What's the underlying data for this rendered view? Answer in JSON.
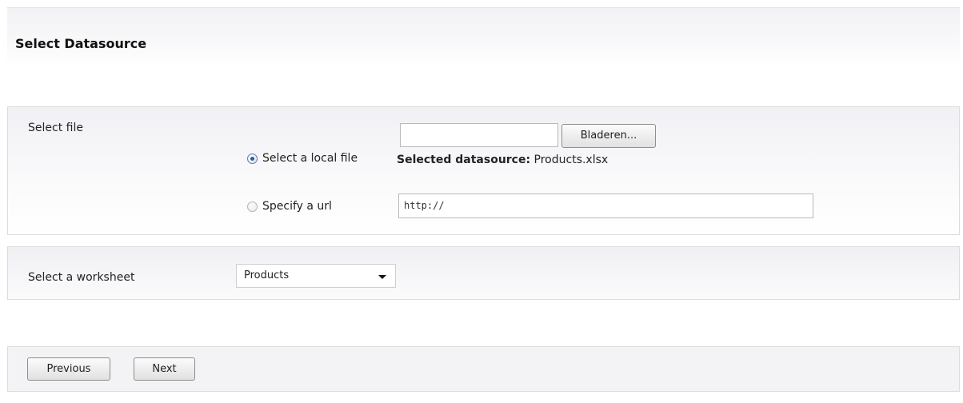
{
  "header": {
    "title": "Select Datasource"
  },
  "file_section": {
    "label": "Select file",
    "file_input": {
      "value": "",
      "browse_label": "Bladeren..."
    },
    "local_option": {
      "label": "Select a local file",
      "selected": true
    },
    "selected_datasource": {
      "label": "Selected datasource:",
      "value": "Products.xlsx"
    },
    "url_option": {
      "label": "Specify a url",
      "selected": false
    },
    "url_input": {
      "value": "http://"
    }
  },
  "worksheet_section": {
    "label": "Select a worksheet",
    "selected": "Products"
  },
  "nav": {
    "previous_label": "Previous",
    "next_label": "Next"
  }
}
